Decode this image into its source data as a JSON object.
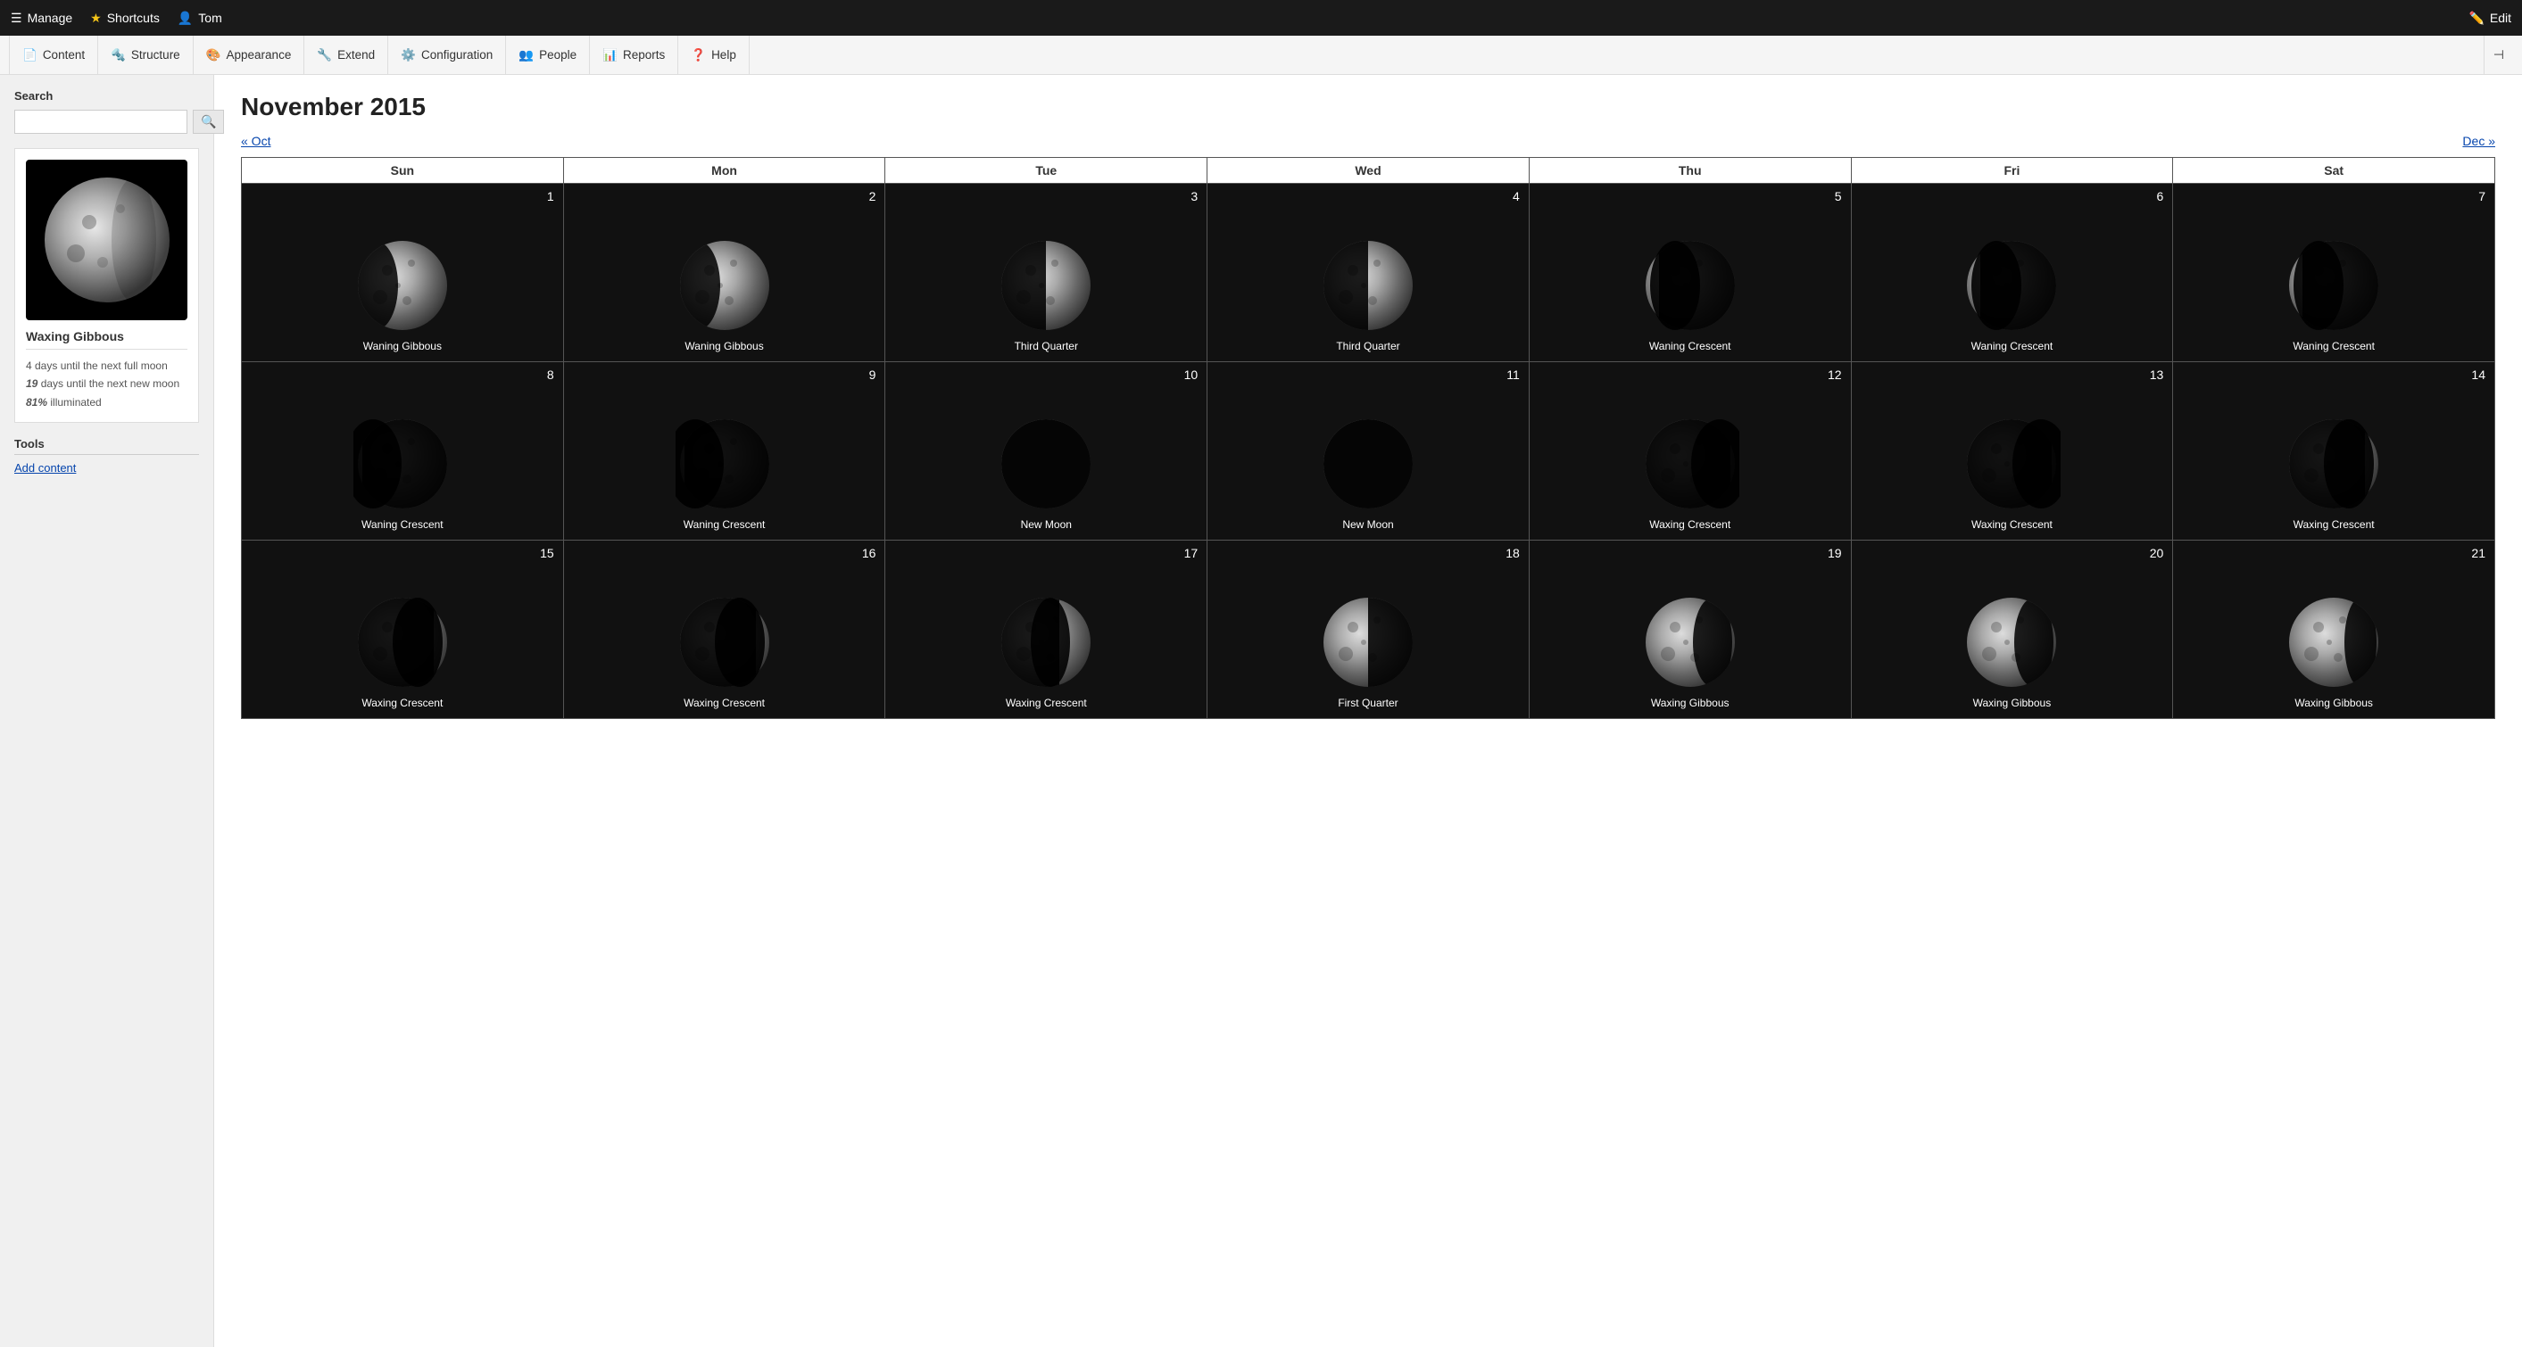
{
  "topbar": {
    "manage_label": "Manage",
    "shortcuts_label": "Shortcuts",
    "user_label": "Tom",
    "edit_label": "Edit"
  },
  "adminmenu": {
    "items": [
      {
        "label": "Content",
        "icon": "content-icon"
      },
      {
        "label": "Structure",
        "icon": "structure-icon"
      },
      {
        "label": "Appearance",
        "icon": "appearance-icon"
      },
      {
        "label": "Extend",
        "icon": "extend-icon"
      },
      {
        "label": "Configuration",
        "icon": "config-icon"
      },
      {
        "label": "People",
        "icon": "people-icon"
      },
      {
        "label": "Reports",
        "icon": "reports-icon"
      },
      {
        "label": "Help",
        "icon": "help-icon"
      }
    ]
  },
  "sidebar": {
    "search_label": "Search",
    "search_placeholder": "",
    "moon_name": "Waxing Gibbous",
    "days_full": "4 days until the next full moon",
    "days_new": "19 days until the next new moon",
    "illuminated": "81% illuminated",
    "tools_label": "Tools",
    "add_content_label": "Add content"
  },
  "calendar": {
    "title": "November 2015",
    "prev_label": "« Oct",
    "next_label": "Dec »",
    "days_of_week": [
      "Sun",
      "Mon",
      "Tue",
      "Wed",
      "Thu",
      "Fri",
      "Sat"
    ],
    "weeks": [
      [
        {
          "day": 1,
          "phase": "Waning Gibbous",
          "type": "waning_gibbous"
        },
        {
          "day": 2,
          "phase": "Waning Gibbous",
          "type": "waning_gibbous"
        },
        {
          "day": 3,
          "phase": "Third Quarter",
          "type": "third_quarter"
        },
        {
          "day": 4,
          "phase": "Third Quarter",
          "type": "third_quarter"
        },
        {
          "day": 5,
          "phase": "Waning Crescent",
          "type": "waning_crescent"
        },
        {
          "day": 6,
          "phase": "Waning Crescent",
          "type": "waning_crescent"
        },
        {
          "day": 7,
          "phase": "Waning Crescent",
          "type": "waning_crescent"
        }
      ],
      [
        {
          "day": 8,
          "phase": "Waning Crescent",
          "type": "waning_crescent_thin"
        },
        {
          "day": 9,
          "phase": "Waning Crescent",
          "type": "waning_crescent_thin"
        },
        {
          "day": 10,
          "phase": "New Moon",
          "type": "new_moon"
        },
        {
          "day": 11,
          "phase": "New Moon",
          "type": "new_moon"
        },
        {
          "day": 12,
          "phase": "Waxing Crescent",
          "type": "waxing_crescent_thin"
        },
        {
          "day": 13,
          "phase": "Waxing Crescent",
          "type": "waxing_crescent_thin"
        },
        {
          "day": 14,
          "phase": "Waxing Crescent",
          "type": "waxing_crescent"
        }
      ],
      [
        {
          "day": 15,
          "phase": "Waxing Crescent",
          "type": "waxing_crescent"
        },
        {
          "day": 16,
          "phase": "Waxing Crescent",
          "type": "waxing_crescent"
        },
        {
          "day": 17,
          "phase": "Waxing Crescent",
          "type": "waxing_crescent_large"
        },
        {
          "day": 18,
          "phase": "First Quarter",
          "type": "first_quarter"
        },
        {
          "day": 19,
          "phase": "Waxing Gibbous",
          "type": "waxing_gibbous"
        },
        {
          "day": 20,
          "phase": "Waxing Gibbous",
          "type": "waxing_gibbous"
        },
        {
          "day": 21,
          "phase": "Waxing Gibbous",
          "type": "waxing_gibbous_large"
        }
      ]
    ]
  }
}
